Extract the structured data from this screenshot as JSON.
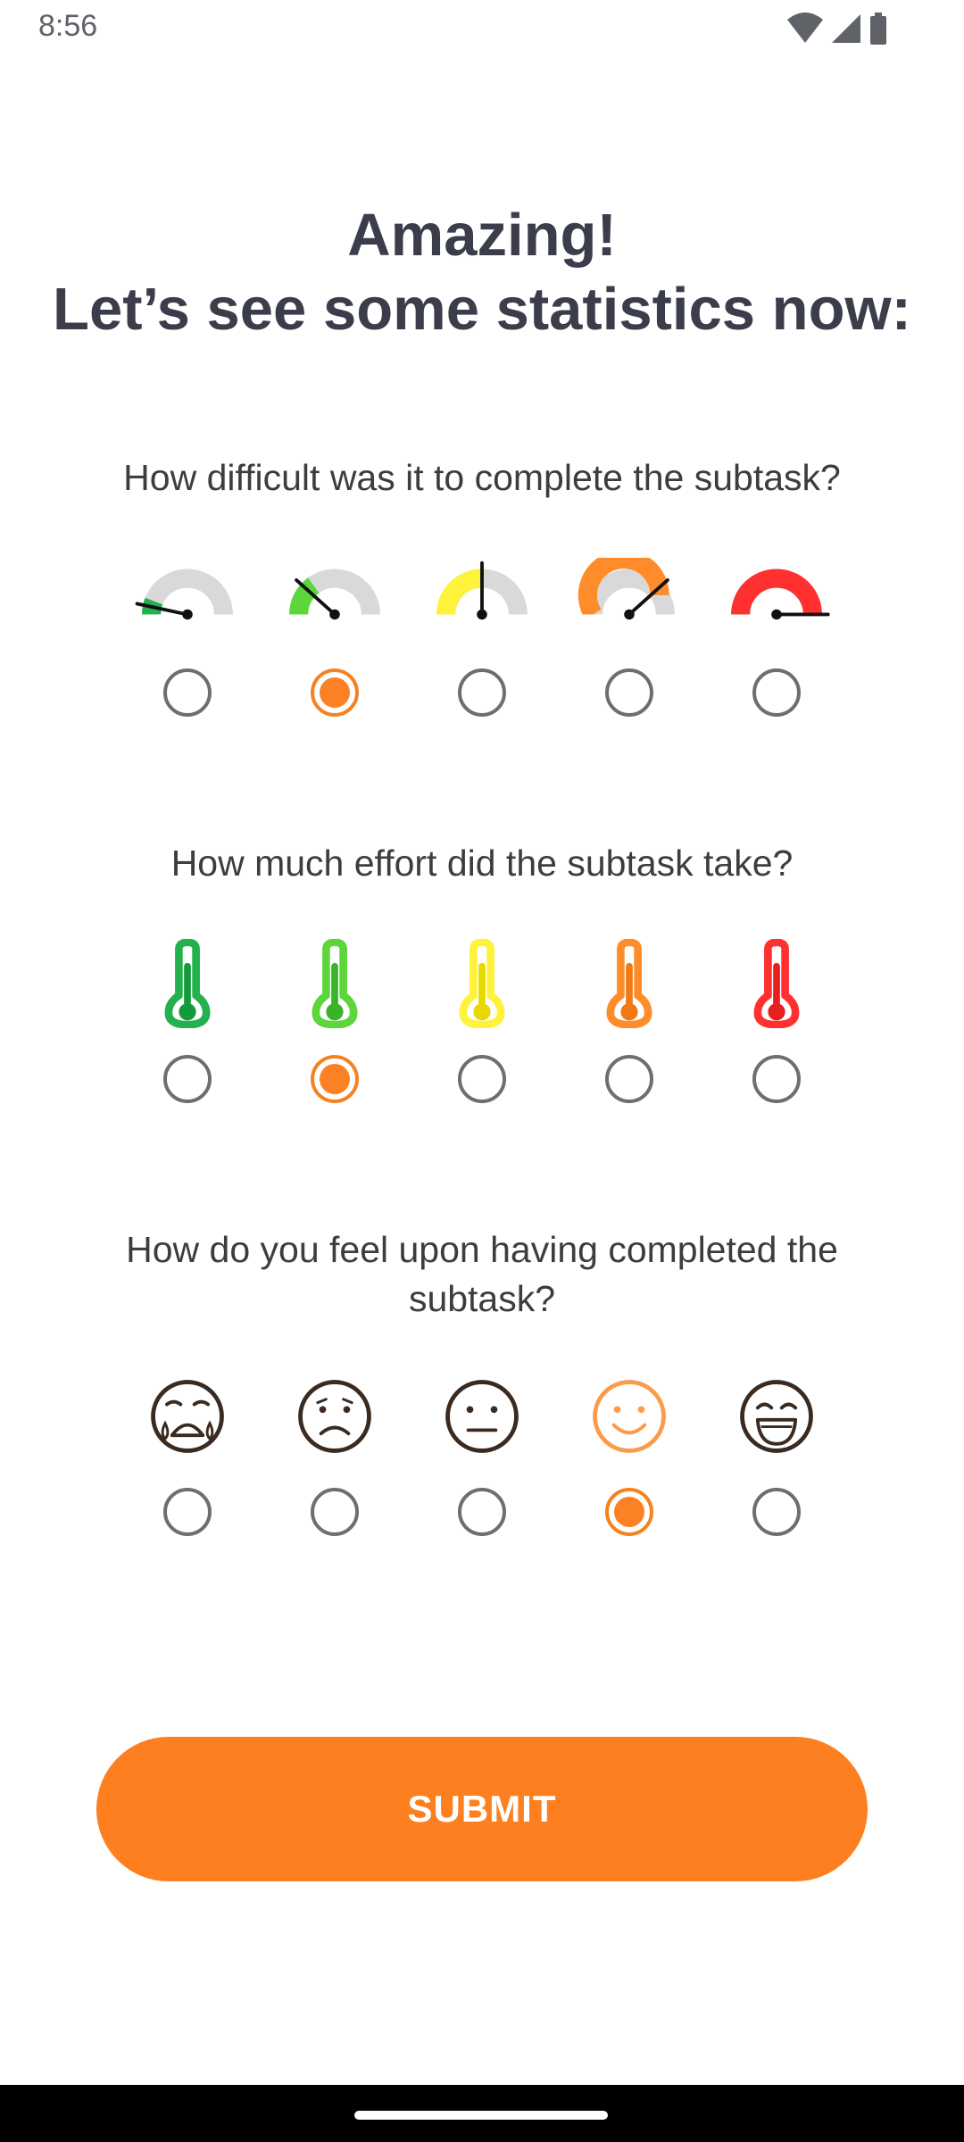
{
  "status_bar": {
    "time": "8:56",
    "icons": [
      "wifi-icon",
      "signal-icon",
      "battery-icon"
    ]
  },
  "title": {
    "line1": "Amazing!",
    "line2": "Let’s see some statistics now:"
  },
  "questions": [
    {
      "text": "How difficult was it to complete the subtask?",
      "icon_set": "gauge",
      "options": [
        "very-easy-gauge-icon",
        "easy-gauge-icon",
        "medium-gauge-icon",
        "hard-gauge-icon",
        "very-hard-gauge-icon"
      ],
      "selected_index": 1
    },
    {
      "text": "How much effort did the subtask take?",
      "icon_set": "thermometer",
      "options": [
        "very-low-effort-thermometer-icon",
        "low-effort-thermometer-icon",
        "medium-effort-thermometer-icon",
        "high-effort-thermometer-icon",
        "very-high-effort-thermometer-icon"
      ],
      "selected_index": 1
    },
    {
      "text": "How do you feel upon having completed the subtask?",
      "icon_set": "emoji",
      "options": [
        "crying-face-icon",
        "sad-face-icon",
        "neutral-face-icon",
        "smiling-face-icon",
        "laughing-face-icon"
      ],
      "selected_index": 3
    }
  ],
  "submit_label": "SUBMIT",
  "colors": {
    "accent": "#fd7f20",
    "radio_border": "#6e6e6e",
    "title": "#3b3d4a",
    "scale": [
      "#22b14c",
      "#5cd63b",
      "#fff23a",
      "#ff8c2a",
      "#ff3030"
    ],
    "face_stroke": "#3a2a20",
    "face_selected": "#fb9b4a"
  }
}
